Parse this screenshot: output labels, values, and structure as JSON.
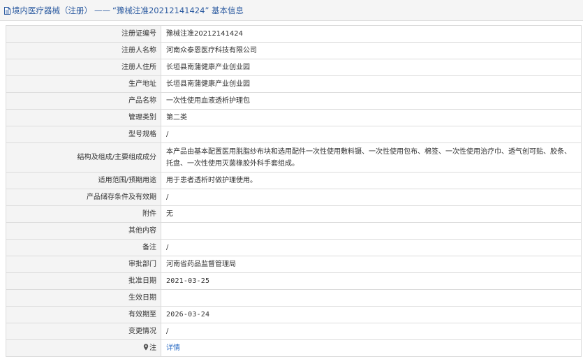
{
  "header": {
    "breadcrumb_root": "境内医疗器械（注册）",
    "separator": "——",
    "record_title": "“豫械注准20212141424” 基本信息"
  },
  "rows": [
    {
      "label": "注册证编号",
      "value": "豫械注准20212141424"
    },
    {
      "label": "注册人名称",
      "value": "河南众泰恩医疗科技有限公司"
    },
    {
      "label": "注册人住所",
      "value": "长垣县南蒲健康产业创业园"
    },
    {
      "label": "生产地址",
      "value": "长垣县南蒲健康产业创业园"
    },
    {
      "label": "产品名称",
      "value": "一次性使用血液透析护理包"
    },
    {
      "label": "管理类别",
      "value": "第二类"
    },
    {
      "label": "型号规格",
      "value": "/"
    },
    {
      "label": "结构及组成/主要组成成分",
      "value": "本产品由基本配置医用脱脂纱布块和选用配件一次性使用敷料镊、一次性使用包布、棉签、一次性使用治疗巾、透气创可贴、胶条、托盘、一次性使用灭菌橡胶外科手套组成。"
    },
    {
      "label": "适用范围/预期用途",
      "value": "用于患者透析时做护理使用。"
    },
    {
      "label": "产品储存条件及有效期",
      "value": "/"
    },
    {
      "label": "附件",
      "value": "无"
    },
    {
      "label": "其他内容",
      "value": ""
    },
    {
      "label": "备注",
      "value": "/"
    },
    {
      "label": "审批部门",
      "value": "河南省药品监督管理局"
    },
    {
      "label": "批准日期",
      "value": "2021-03-25"
    },
    {
      "label": "生效日期",
      "value": ""
    },
    {
      "label": "有效期至",
      "value": "2026-03-24"
    },
    {
      "label": "变更情况",
      "value": "/"
    },
    {
      "label": "注",
      "value": "详情"
    }
  ],
  "icons": {
    "header": "document-icon",
    "note": "map-pin-icon"
  },
  "colors": {
    "header_text": "#2b5aa0",
    "link": "#2b6cc4",
    "label_bg": "#f4f4f4",
    "border": "#dcdcdc"
  }
}
